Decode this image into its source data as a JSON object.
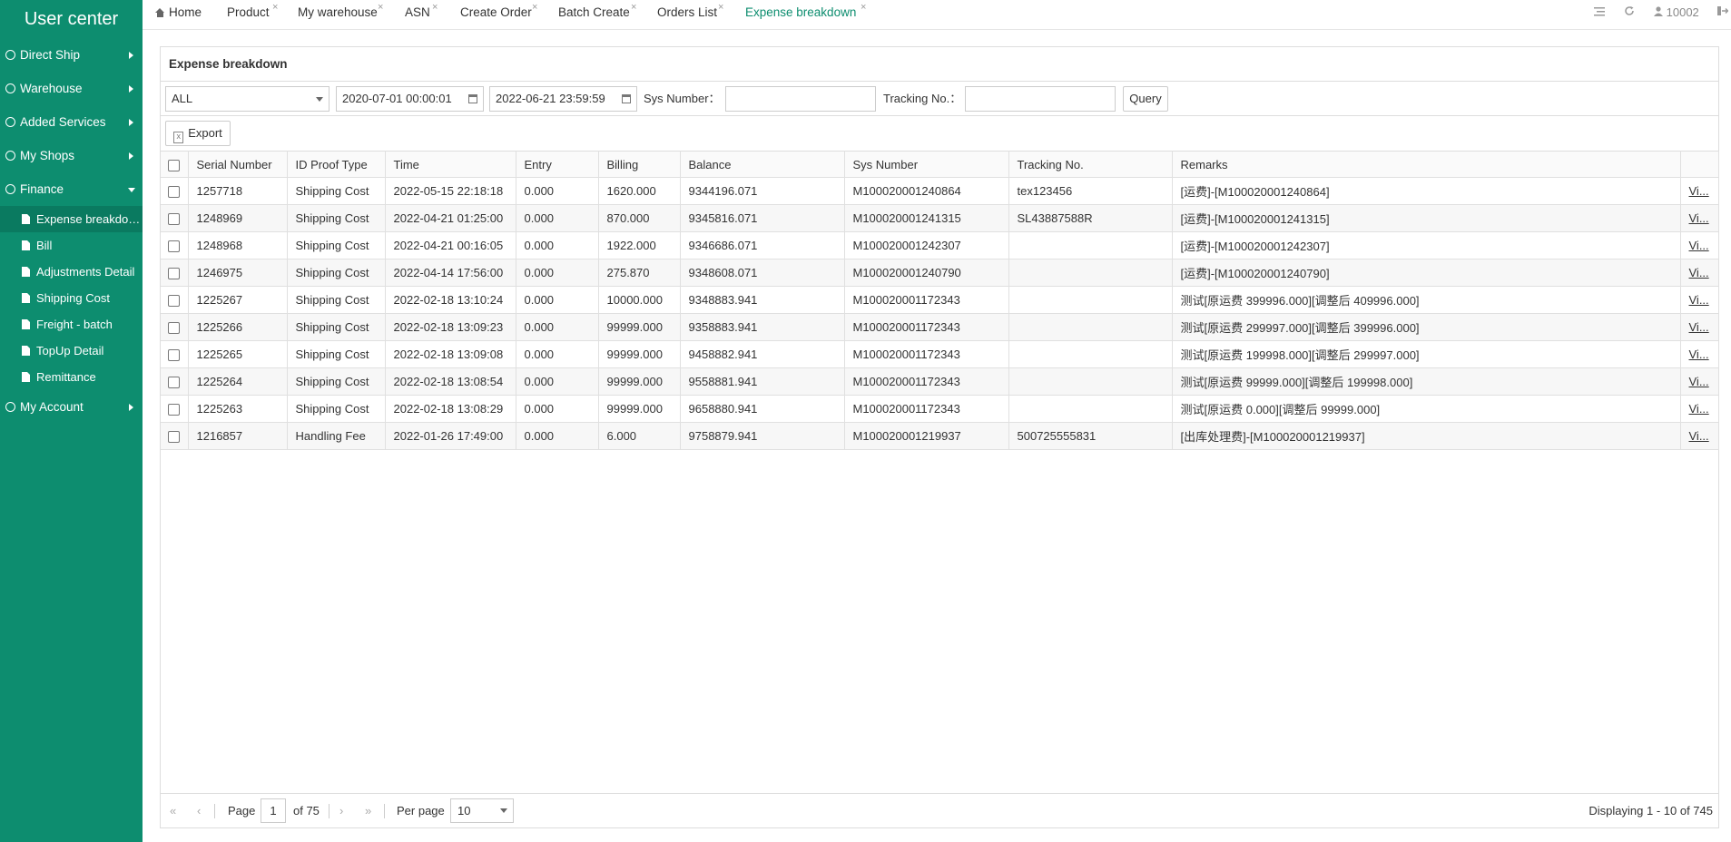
{
  "sidebar": {
    "brand": "User center",
    "items": [
      {
        "label": "Direct Ship"
      },
      {
        "label": "Warehouse"
      },
      {
        "label": "Added Services"
      },
      {
        "label": "My Shops"
      },
      {
        "label": "Finance"
      },
      {
        "label": "My Account"
      }
    ],
    "finance_sub": [
      {
        "label": "Expense breakdown"
      },
      {
        "label": "Bill"
      },
      {
        "label": "Adjustments Detail"
      },
      {
        "label": "Shipping Cost"
      },
      {
        "label": "Freight - batch"
      },
      {
        "label": "TopUp Detail"
      },
      {
        "label": "Remittance"
      }
    ]
  },
  "tabs": [
    {
      "label": "Home"
    },
    {
      "label": "Product"
    },
    {
      "label": "My warehouse"
    },
    {
      "label": "ASN"
    },
    {
      "label": "Create Order"
    },
    {
      "label": "Batch Create"
    },
    {
      "label": "Orders List"
    },
    {
      "label": "Expense breakdown"
    }
  ],
  "tab_close": "×",
  "topright": {
    "user": "10002"
  },
  "panel": {
    "title": "Expense breakdown"
  },
  "filters": {
    "type_value": "ALL",
    "date_from": "2020-07-01 00:00:01",
    "date_to": "2022-06-21 23:59:59",
    "sys_label": "Sys Number：",
    "tracking_label": "Tracking No.：",
    "query_label": "Query",
    "export_label": "Export"
  },
  "table": {
    "headers": [
      "Serial Number",
      "ID Proof Type",
      "Time",
      "Entry",
      "Billing",
      "Balance",
      "Sys Number",
      "Tracking No.",
      "Remarks"
    ],
    "rows": [
      [
        "1257718",
        "Shipping Cost",
        "2022-05-15 22:18:18",
        "0.000",
        "1620.000",
        "9344196.071",
        "M100020001240864",
        "tex123456",
        "[运费]-[M100020001240864]",
        "Vi..."
      ],
      [
        "1248969",
        "Shipping Cost",
        "2022-04-21 01:25:00",
        "0.000",
        "870.000",
        "9345816.071",
        "M100020001241315",
        "SL43887588R",
        "[运费]-[M100020001241315]",
        "Vi..."
      ],
      [
        "1248968",
        "Shipping Cost",
        "2022-04-21 00:16:05",
        "0.000",
        "1922.000",
        "9346686.071",
        "M100020001242307",
        "",
        "[运费]-[M100020001242307]",
        "Vi..."
      ],
      [
        "1246975",
        "Shipping Cost",
        "2022-04-14 17:56:00",
        "0.000",
        "275.870",
        "9348608.071",
        "M100020001240790",
        "",
        "[运费]-[M100020001240790]",
        "Vi..."
      ],
      [
        "1225267",
        "Shipping Cost",
        "2022-02-18 13:10:24",
        "0.000",
        "10000.000",
        "9348883.941",
        "M100020001172343",
        "",
        "测试[原运费 399996.000][调整后 409996.000]",
        "Vi..."
      ],
      [
        "1225266",
        "Shipping Cost",
        "2022-02-18 13:09:23",
        "0.000",
        "99999.000",
        "9358883.941",
        "M100020001172343",
        "",
        "测试[原运费 299997.000][调整后 399996.000]",
        "Vi..."
      ],
      [
        "1225265",
        "Shipping Cost",
        "2022-02-18 13:09:08",
        "0.000",
        "99999.000",
        "9458882.941",
        "M100020001172343",
        "",
        "测试[原运费 199998.000][调整后 299997.000]",
        "Vi..."
      ],
      [
        "1225264",
        "Shipping Cost",
        "2022-02-18 13:08:54",
        "0.000",
        "99999.000",
        "9558881.941",
        "M100020001172343",
        "",
        "测试[原运费 99999.000][调整后 199998.000]",
        "Vi..."
      ],
      [
        "1225263",
        "Shipping Cost",
        "2022-02-18 13:08:29",
        "0.000",
        "99999.000",
        "9658880.941",
        "M100020001172343",
        "",
        "测试[原运费 0.000][调整后 99999.000]",
        "Vi..."
      ],
      [
        "1216857",
        "Handling Fee",
        "2022-01-26 17:49:00",
        "0.000",
        "6.000",
        "9758879.941",
        "M100020001219937",
        "500725555831",
        "[出库处理费]-[M100020001219937]",
        "Vi..."
      ]
    ]
  },
  "pager": {
    "page_label": "Page",
    "page_value": "1",
    "of_label": "of 75",
    "per_page_label": "Per page",
    "per_page_value": "10",
    "display_text": "Displaying 1 - 10 of 745"
  }
}
